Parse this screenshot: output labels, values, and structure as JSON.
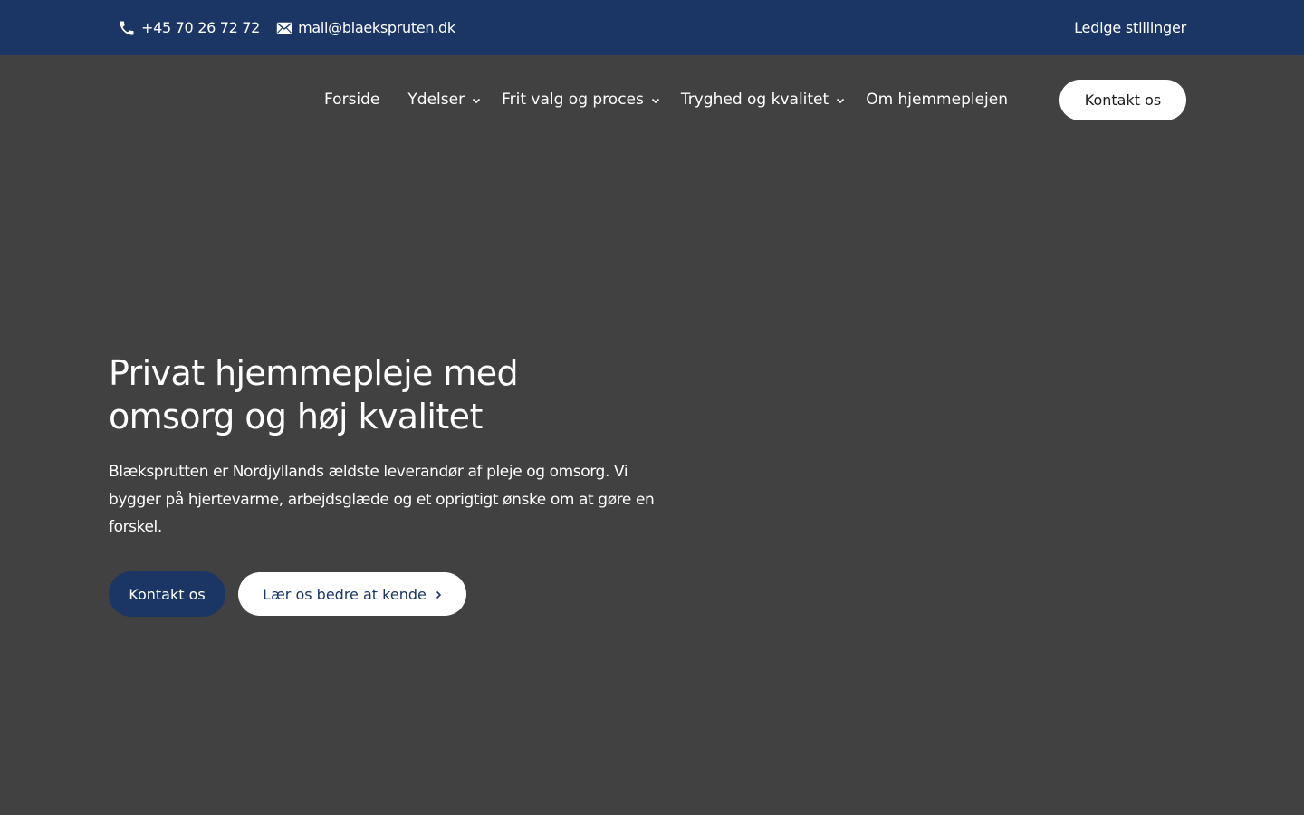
{
  "topbar": {
    "phone": "+45 70 26 72 72",
    "phone_icon": "phone-icon",
    "email": "mail@blaekspruten.dk",
    "email_icon": "envelope-icon",
    "right_link": "Ledige stillinger"
  },
  "nav": {
    "items": [
      {
        "label": "Forside",
        "dropdown": false
      },
      {
        "label": "Ydelser",
        "dropdown": true
      },
      {
        "label": "Frit valg og proces",
        "dropdown": true
      },
      {
        "label": "Tryghed og kvalitet",
        "dropdown": true
      },
      {
        "label": "Om hjemmeplejen",
        "dropdown": false
      }
    ],
    "cta": "Kontakt os",
    "dropdown_icon": "chevron-down-icon"
  },
  "hero": {
    "title_line1": "Privat hjemmepleje med",
    "title_line2": "omsorg og høj kvalitet",
    "text": "Blæksprutten er Nordjyllands ældste leverandør af pleje og omsorg. Vi bygger på hjertevarme, arbejdsglæde og et oprigtigt ønske om at gøre en forskel.",
    "primary_button": "Kontakt os",
    "secondary_button": "Lær os bedre at kende",
    "secondary_icon": "chevron-right-icon"
  },
  "colors": {
    "brand_navy": "#1b3664",
    "background": "#414141",
    "white": "#ffffff"
  }
}
